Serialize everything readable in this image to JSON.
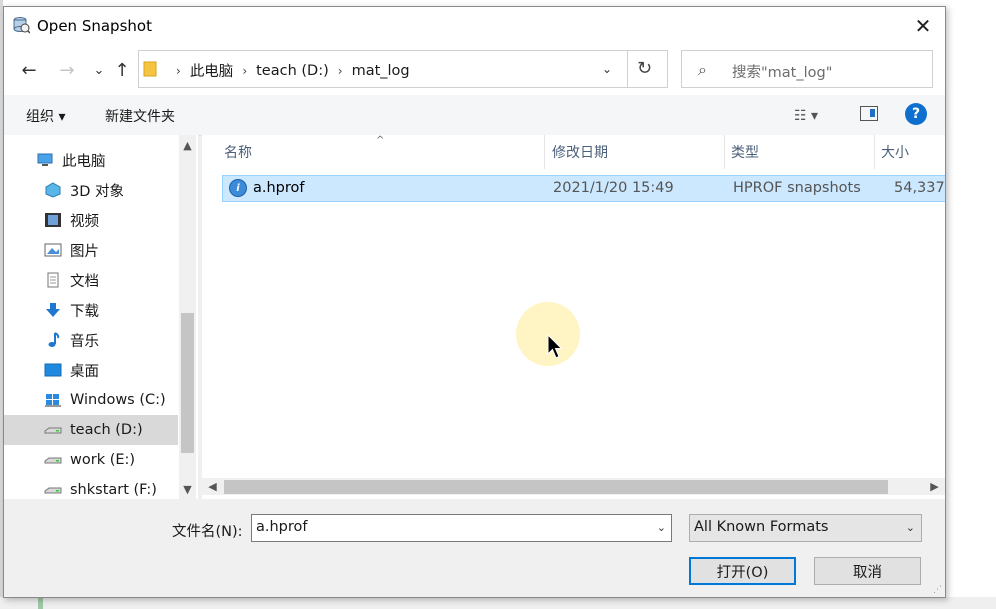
{
  "window": {
    "title": "Open Snapshot",
    "close_glyph": "✕"
  },
  "nav": {
    "back_glyph": "←",
    "forward_glyph": "→",
    "recent_glyph": "⌄",
    "up_glyph": "↑",
    "breadcrumbs": [
      "此电脑",
      "teach (D:)",
      "mat_log"
    ],
    "crumb_separator": "›",
    "dropdown_glyph": "⌄",
    "refresh_glyph": "↻",
    "search_icon_glyph": "⌕",
    "search_placeholder": "搜索\"mat_log\""
  },
  "toolbar": {
    "organize_label": "组织 ▾",
    "new_folder_label": "新建文件夹",
    "view_label": "☷ ▾",
    "help_label": "?"
  },
  "sidebar": {
    "items": [
      {
        "label": "此电脑",
        "icon": "computer-icon",
        "selected": false
      },
      {
        "label": "3D 对象",
        "icon": "cube-3d-icon",
        "selected": false
      },
      {
        "label": "视频",
        "icon": "film-icon",
        "selected": false
      },
      {
        "label": "图片",
        "icon": "picture-icon",
        "selected": false
      },
      {
        "label": "文档",
        "icon": "document-icon",
        "selected": false
      },
      {
        "label": "下载",
        "icon": "download-arrow-icon",
        "selected": false
      },
      {
        "label": "音乐",
        "icon": "music-note-icon",
        "selected": false
      },
      {
        "label": "桌面",
        "icon": "desktop-icon",
        "selected": false
      },
      {
        "label": "Windows (C:)",
        "icon": "windows-drive-icon",
        "selected": false
      },
      {
        "label": "teach (D:)",
        "icon": "drive-icon",
        "selected": true
      },
      {
        "label": "work (E:)",
        "icon": "drive-icon",
        "selected": false
      },
      {
        "label": "shkstart (F:)",
        "icon": "drive-icon",
        "selected": false
      }
    ],
    "scroll_up_glyph": "▲",
    "scroll_down_glyph": "▼"
  },
  "files": {
    "columns": {
      "name": "名称",
      "modified": "修改日期",
      "type": "类型",
      "size": "大小"
    },
    "sort_glyph": "^",
    "rows": [
      {
        "name": "a.hprof",
        "modified": "2021/1/20 15:49",
        "type": "HPROF snapshots",
        "size": "54,337",
        "icon": "hprof-file-icon",
        "selected": true
      }
    ],
    "scroll_left_glyph": "◀",
    "scroll_right_glyph": "▶"
  },
  "footer": {
    "filename_label": "文件名(N):",
    "filename_value": "a.hprof",
    "dropdown_glyph": "⌄",
    "filter_value": "All Known Formats",
    "open_label": "打开(O)",
    "cancel_label": "取消",
    "grip_glyph": "⋰"
  },
  "colors": {
    "selection_bg": "#cce8ff",
    "selection_border": "#99d1ff",
    "accent": "#0078d7",
    "help_blue": "#0f6fcf"
  }
}
